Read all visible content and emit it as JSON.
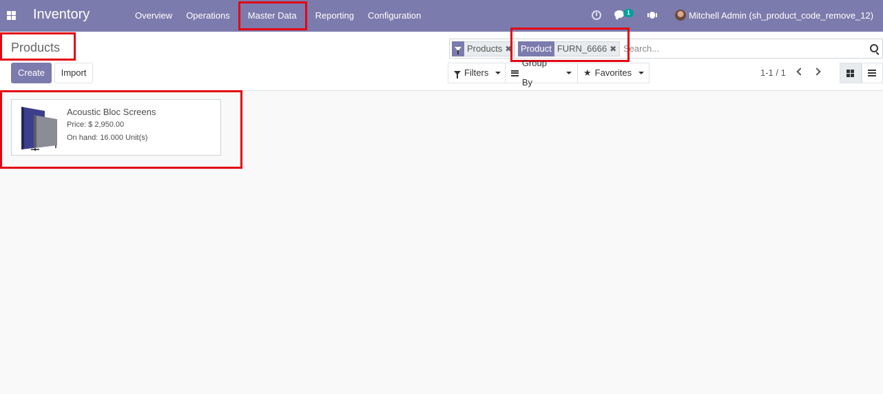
{
  "navbar": {
    "brand": "Inventory",
    "menu": [
      {
        "label": "Overview"
      },
      {
        "label": "Operations"
      },
      {
        "label": "Master Data"
      },
      {
        "label": "Reporting"
      },
      {
        "label": "Configuration"
      }
    ],
    "chat_badge": "1",
    "user": "Mitchell Admin (sh_product_code_remove_12)"
  },
  "control": {
    "title": "Products",
    "create_label": "Create",
    "import_label": "Import",
    "facets": [
      {
        "label": "",
        "value": "Products"
      },
      {
        "label": "Product",
        "value": "FURN_6666"
      }
    ],
    "search_placeholder": "Search...",
    "filters_label": "Filters",
    "groupby_label": "Group By",
    "favorites_label": "Favorites",
    "pager": "1-1 / 1"
  },
  "products": [
    {
      "name": "Acoustic Bloc Screens",
      "price": "Price: $ 2,950.00",
      "onhand": "On hand: 16.000 Unit(s)"
    }
  ],
  "colors": {
    "brand": "#7c7bad",
    "highlight": "#e30613"
  }
}
